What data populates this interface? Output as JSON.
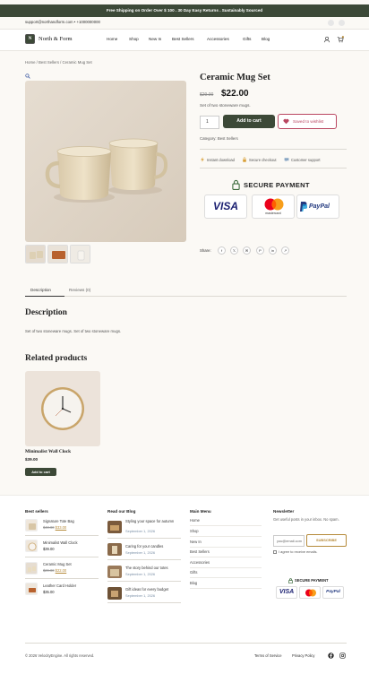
{
  "promo": "Free Shipping on Order Over $ 100 . 30 Day Easy Returns . Sustainably Sourced",
  "contact": "support@northandform.com • +1000000000",
  "brand": {
    "name": "North & Form",
    "mark": "N"
  },
  "nav": [
    "Home",
    "Shop",
    "New In",
    "Best Sellers",
    "Accessories",
    "Gifts",
    "Blog"
  ],
  "breadcrumb": "Home / Best Sellers / Ceramic Mug Set",
  "product": {
    "title": "Ceramic Mug Set",
    "old_price": "$29.00",
    "price": "$22.00",
    "short_desc": "Set of two stoneware mugs.",
    "qty": "1",
    "add_to_cart": "Add to cart",
    "wishlist": "Saved to wishlist",
    "category": "Category: Best Sellers"
  },
  "features": [
    "Instant download",
    "Secure checkout",
    "Customer support"
  ],
  "secure_payment": "SECURE PAYMENT",
  "cards": {
    "visa": "VISA",
    "mastercard": "mastercard",
    "paypal": "PayPal"
  },
  "share_label": "Share:",
  "share_icons": [
    "f",
    "𝕏",
    "✉",
    "P",
    "in",
    "↗"
  ],
  "tabs": [
    "Description",
    "Reviews (0)"
  ],
  "description": {
    "heading": "Description",
    "text": "Set of two stoneware mugs. Set of two stoneware mugs."
  },
  "related": {
    "heading": "Related products",
    "name": "Minimalist Wall Clock",
    "price": "$39.00",
    "button": "Add to cart"
  },
  "footer": {
    "best_sellers": {
      "title": "Best sellers",
      "items": [
        {
          "name": "Signature Tote Bag",
          "old": "$40.00",
          "new": "$33.00"
        },
        {
          "name": "Minimalist Wall Clock",
          "price": "$39.00"
        },
        {
          "name": "Ceramic Mug Set",
          "old": "$29.00",
          "new": "$22.00"
        },
        {
          "name": "Leather Card Holder",
          "price": "$35.00"
        }
      ]
    },
    "blog": {
      "title": "Read our Blog",
      "items": [
        {
          "title": "Styling your space for autumn",
          "date": "September 1, 2026"
        },
        {
          "title": "Caring for your candles",
          "date": "September 1, 2026"
        },
        {
          "title": "The story behind our totes",
          "date": "September 1, 2026"
        },
        {
          "title": "Gift ideas for every budget",
          "date": "September 1, 2026"
        }
      ]
    },
    "menu": {
      "title": "Main Menu",
      "items": [
        "Home",
        "Shop",
        "New In",
        "Best Sellers",
        "Accessories",
        "Gifts",
        "Blog"
      ]
    },
    "newsletter": {
      "title": "Newsletter",
      "text": "Get useful posts in your inbox. No spam.",
      "placeholder": "you@email.com",
      "button": "SUBSCRIBE",
      "agree": "I agree to receive emails."
    },
    "secure_payment": "SECURE PAYMENT",
    "copyright": "© 2026 VelocityEngine. All rights reserved.",
    "links": [
      "Terms of Service",
      "Privacy Policy"
    ]
  },
  "colors": {
    "accent": "#3c4937",
    "wishlist": "#b94660",
    "gold": "#b58a3a"
  }
}
